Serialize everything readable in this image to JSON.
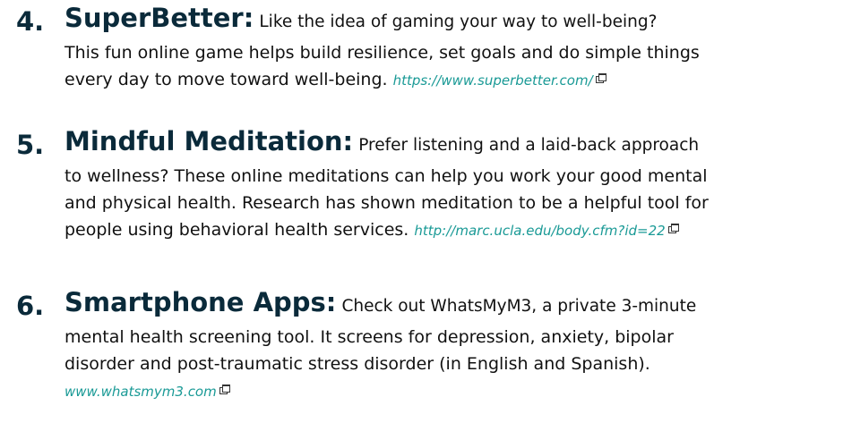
{
  "items": [
    {
      "number": "4.",
      "title": "SuperBetter:",
      "lines": [
        "Like the idea of gaming your way to well-being?",
        "This fun online game helps build resilience, set goals and do simple things",
        "every day to move toward well-being."
      ],
      "link": "https://www.superbetter.com/",
      "link_icon": "external-link-icon"
    },
    {
      "number": "5.",
      "title": "Mindful Meditation:",
      "lines": [
        "Prefer listening and a laid-back approach",
        "to wellness? These online meditations can help you work your good mental",
        "and physical health. Research has shown meditation to be a helpful tool for",
        "people using behavioral health services."
      ],
      "link": "http://marc.ucla.edu/body.cfm?id=22",
      "link_icon": "external-link-icon"
    },
    {
      "number": "6.",
      "title": "Smartphone Apps:",
      "lines": [
        "Check out WhatsMyM3, a private 3-minute",
        "mental health screening tool. It screens for depression, anxiety, bipolar",
        "disorder and post-traumatic stress disorder (in English and Spanish)."
      ],
      "link": "www.whatsmym3.com",
      "link_icon": "external-link-icon"
    }
  ],
  "colors": {
    "heading": "#0a2a3a",
    "text": "#111111",
    "link": "#1a9a96"
  }
}
